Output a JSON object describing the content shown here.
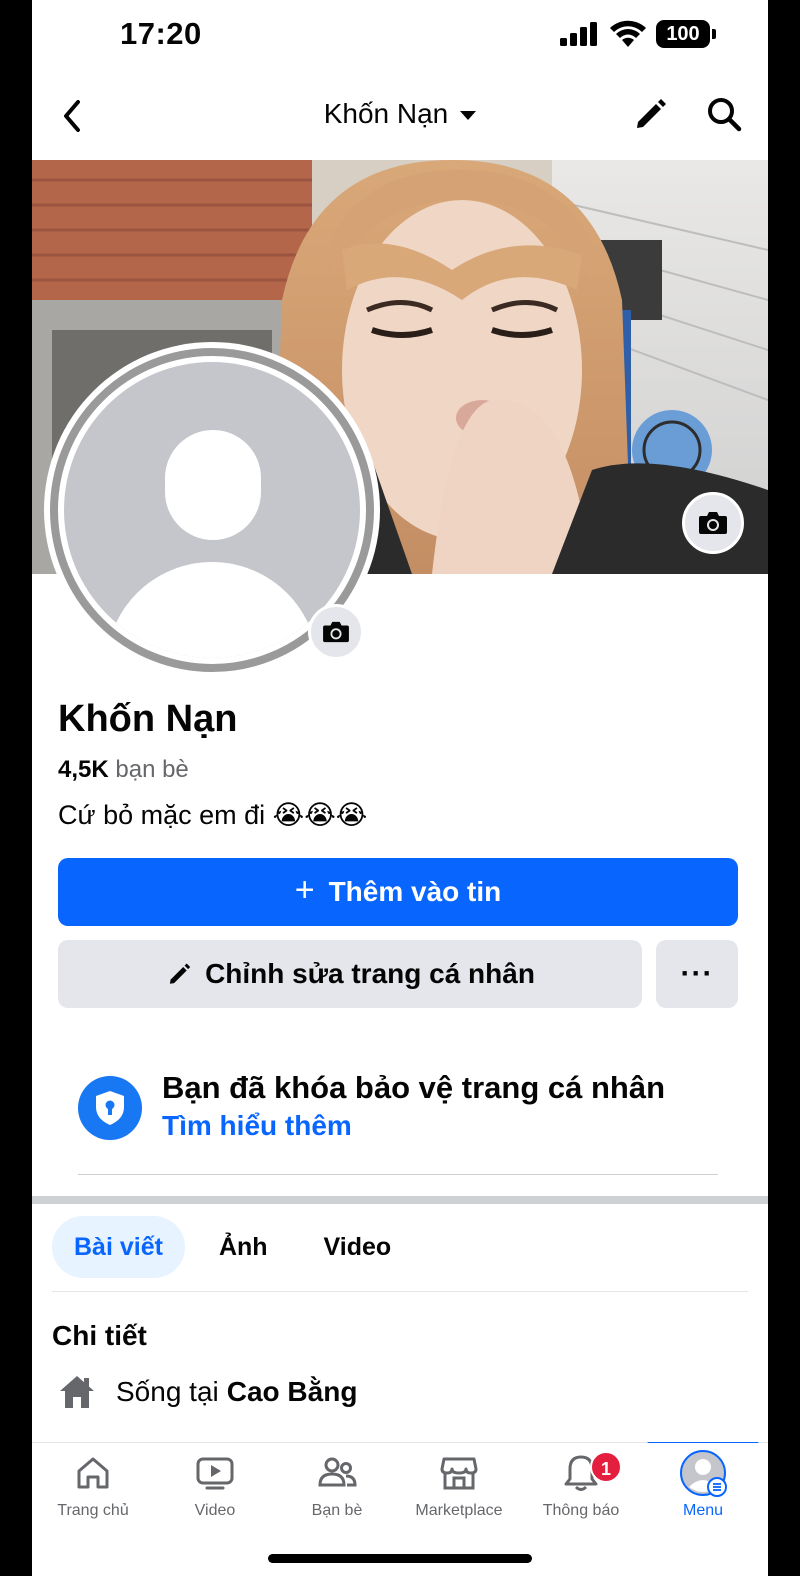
{
  "status_bar": {
    "time": "17:20",
    "battery": "100"
  },
  "header": {
    "title": "Khốn Nạn"
  },
  "profile": {
    "name": "Khốn Nạn",
    "friends_count": "4,5K",
    "friends_label": "bạn bè",
    "bio_text": "Cứ bỏ mặc em đi",
    "bio_emojis": "😭😭😭"
  },
  "actions": {
    "add_story_plus": "+",
    "add_story_label": "Thêm vào tin",
    "edit_profile_label": "Chỉnh sửa trang cá nhân",
    "more_label": "···"
  },
  "lock_notice": {
    "title": "Bạn đã khóa bảo vệ trang cá nhân",
    "link": "Tìm hiểu thêm"
  },
  "tabs": [
    {
      "label": "Bài viết",
      "active": true
    },
    {
      "label": "Ảnh",
      "active": false
    },
    {
      "label": "Video",
      "active": false
    }
  ],
  "details": {
    "title": "Chi tiết",
    "lives_in_prefix": "Sống tại",
    "lives_in_place": "Cao Bằng"
  },
  "bottom_nav": [
    {
      "label": "Trang chủ",
      "icon": "home-icon"
    },
    {
      "label": "Video",
      "icon": "video-icon"
    },
    {
      "label": "Bạn bè",
      "icon": "friends-icon"
    },
    {
      "label": "Marketplace",
      "icon": "marketplace-icon"
    },
    {
      "label": "Thông báo",
      "icon": "bell-icon",
      "badge": "1"
    },
    {
      "label": "Menu",
      "icon": "menu-avatar-icon",
      "active": true
    }
  ],
  "colors": {
    "primary": "#0866ff",
    "secondary_bg": "#e4e6eb",
    "badge": "#e41e3f"
  }
}
